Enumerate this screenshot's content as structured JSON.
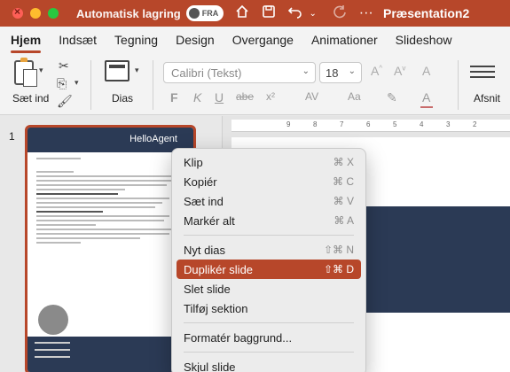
{
  "titlebar": {
    "autosave_label": "Automatisk lagring",
    "autosave_state": "FRA",
    "document_title": "Præsentation2",
    "icons": [
      "home-icon",
      "save-icon",
      "undo-icon",
      "redo-icon",
      "more-icon"
    ],
    "more_glyph": "···"
  },
  "tabs": [
    "Hjem",
    "Indsæt",
    "Tegning",
    "Design",
    "Overgange",
    "Animationer",
    "Slideshow"
  ],
  "ribbon": {
    "paste_label": "Sæt ind",
    "slides_label": "Dias",
    "font_name": "Calibri (Tekst)",
    "font_size": "18",
    "paragraph_label": "Afsnit",
    "format_buttons": [
      "F",
      "K",
      "U",
      "abe",
      "x²",
      "AV",
      "Aa"
    ]
  },
  "thumbnail": {
    "slide_number": "1",
    "brand": "HelloAgent"
  },
  "ruler": [
    "9",
    "8",
    "7",
    "6",
    "5",
    "4",
    "3",
    "2"
  ],
  "context_menu": {
    "groups": [
      [
        {
          "label": "Klip",
          "shortcut": "⌘ X"
        },
        {
          "label": "Kopiér",
          "shortcut": "⌘ C"
        },
        {
          "label": "Sæt ind",
          "shortcut": "⌘ V"
        },
        {
          "label": "Markér alt",
          "shortcut": "⌘ A"
        }
      ],
      [
        {
          "label": "Nyt dias",
          "shortcut": "⇧⌘ N"
        },
        {
          "label": "Duplikér slide",
          "shortcut": "⇧⌘ D",
          "highlighted": true
        },
        {
          "label": "Slet slide",
          "shortcut": ""
        },
        {
          "label": "Tilføj sektion",
          "shortcut": ""
        }
      ],
      [
        {
          "label": "Formatér baggrund...",
          "shortcut": ""
        }
      ],
      [
        {
          "label": "Skjul slide",
          "shortcut": ""
        }
      ]
    ]
  },
  "colors": {
    "accent": "#b7472a",
    "slide_navy": "#2b3a55"
  }
}
